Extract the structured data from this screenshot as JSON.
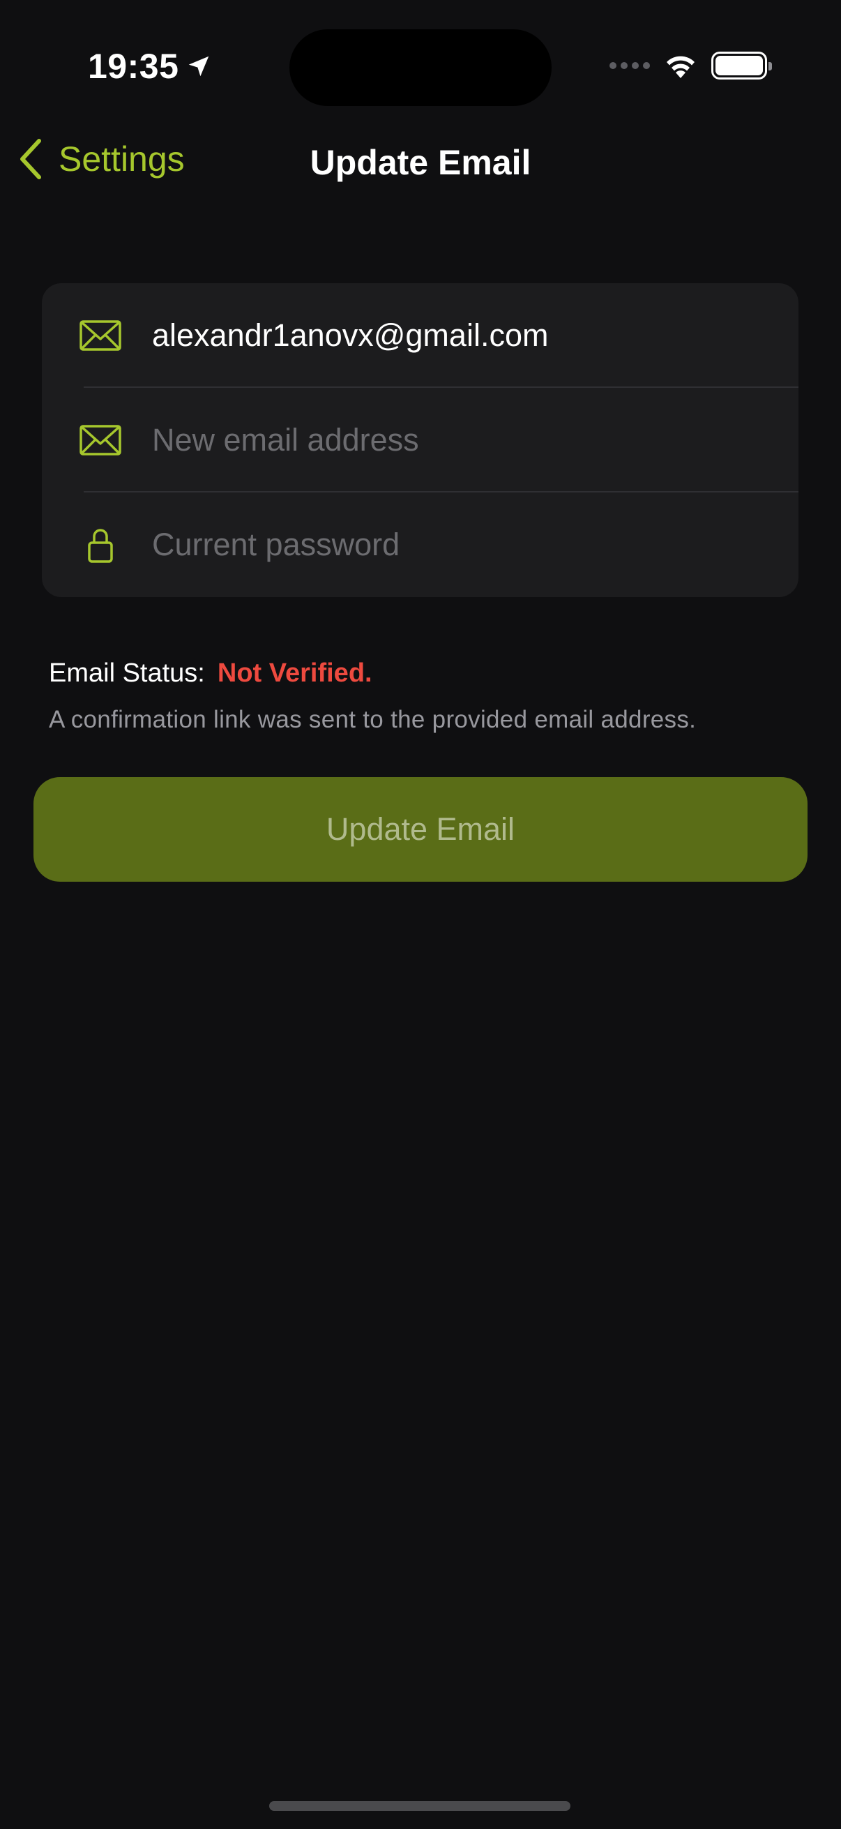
{
  "status_bar": {
    "time": "19:35",
    "location_icon": "location-arrow-icon",
    "wifi_icon": "wifi-icon",
    "battery_icon": "battery-icon"
  },
  "nav": {
    "back_label": "Settings",
    "back_icon": "chevron-left-icon",
    "title": "Update Email"
  },
  "form": {
    "current_email": {
      "value": "alexandr1anovx@gmail.com",
      "icon": "envelope-icon"
    },
    "new_email": {
      "value": "",
      "placeholder": "New email address",
      "icon": "envelope-icon"
    },
    "password": {
      "value": "",
      "placeholder": "Current password",
      "icon": "lock-icon"
    }
  },
  "email_status": {
    "label": "Email Status:",
    "value": "Not Verified.",
    "note": "A confirmation link was sent to the provided email address."
  },
  "submit": {
    "label": "Update Email"
  },
  "colors": {
    "background": "#0f0f11",
    "card": "#1c1c1e",
    "accent": "#a6c72d",
    "button": "#5a6d17",
    "error": "#ee4a3f"
  }
}
